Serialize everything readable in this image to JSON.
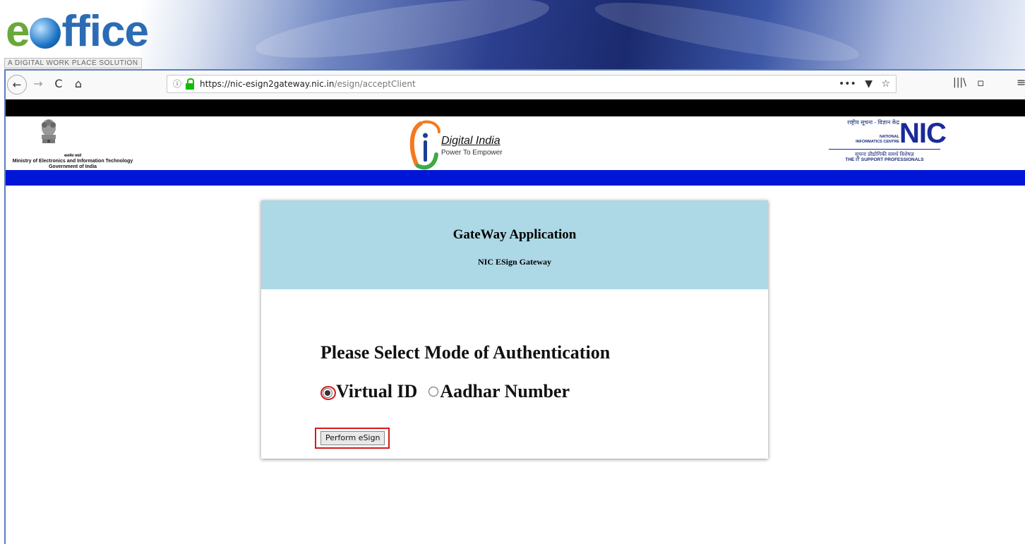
{
  "banner": {
    "logo_e": "e",
    "logo_rest": "ffice",
    "tagline": "A DIGITAL WORK PLACE SOLUTION"
  },
  "browser": {
    "back_icon": "←",
    "forward_icon": "→",
    "reload_icon": "C",
    "home_icon": "⌂",
    "info_icon": "ⓘ",
    "url_host": "https://nic-esign2gateway.nic.in",
    "url_path": "/esign/acceptClient",
    "page_actions_icon": "•••",
    "pocket_icon": "▼",
    "bookmark_icon": "☆",
    "library_icon": "|||\\",
    "sidebar_icon": "▫",
    "menu_icon": "≡"
  },
  "header": {
    "ministry_hindi": "सत्यमेव जयते",
    "ministry_line1": "Ministry of Electronics and Information Technology",
    "ministry_line2": "Government of India",
    "di_title": "Digital India",
    "di_subtitle": "Power To Empower",
    "nic_hindi_top": "राष्ट्रीय सूचना - विज्ञान केंद्र",
    "nic_eng_1": "NATIONAL",
    "nic_eng_2": "INFORMATICS CENTRE",
    "nic_letters": "NIC",
    "nic_hindi_bottom": "सूचना प्रौद्योगिकी समर्थ विशेषज्ञ",
    "nic_tagline": "THE IT SUPPORT PROFESSIONALS"
  },
  "card": {
    "title": "GateWay Application",
    "subtitle": "NIC ESign Gateway",
    "auth_heading": "Please Select Mode of Authentication",
    "option_virtual_id": "Virtual ID",
    "option_aadhar": "Aadhar Number",
    "selected_option": "Virtual ID",
    "esign_button": "Perform eSign"
  },
  "colors": {
    "black_bar": "#000000",
    "blue_bar": "#0016d6",
    "card_header": "#add8e6",
    "highlight": "#d51a1a",
    "lock": "#12bc00"
  }
}
